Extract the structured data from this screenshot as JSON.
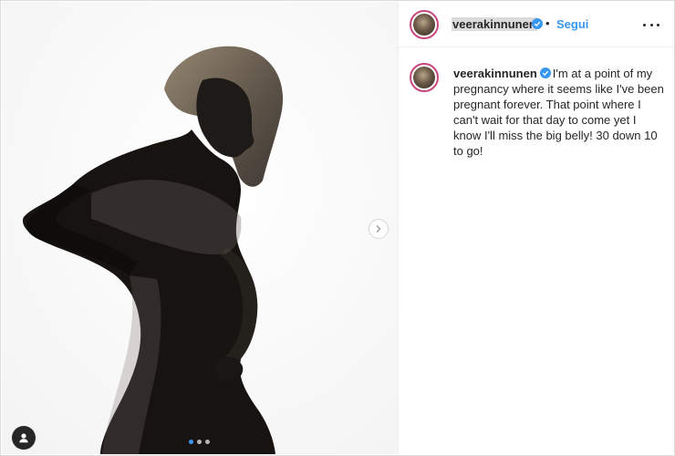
{
  "post": {
    "username": "veerakinnunen",
    "follow_label": "Segui",
    "separator": "•",
    "caption_text": "I'm at a point of my pregnancy where it seems like I've been pregnant forever. That point where I can't wait for that day to come yet I know I'll miss the big belly! 30 down 10 to go!",
    "carousel": {
      "total_slides": 3,
      "current_slide": 1
    }
  },
  "icons": {
    "verified": "verified-badge-icon",
    "more": "more-options-icon",
    "next": "chevron-right-icon",
    "tagged_user": "user-tag-icon"
  },
  "colors": {
    "link_blue": "#3897f0",
    "verified_blue": "#3897f0",
    "story_ring": "#c9467b",
    "text": "#262626",
    "border": "#dbdbdb"
  }
}
